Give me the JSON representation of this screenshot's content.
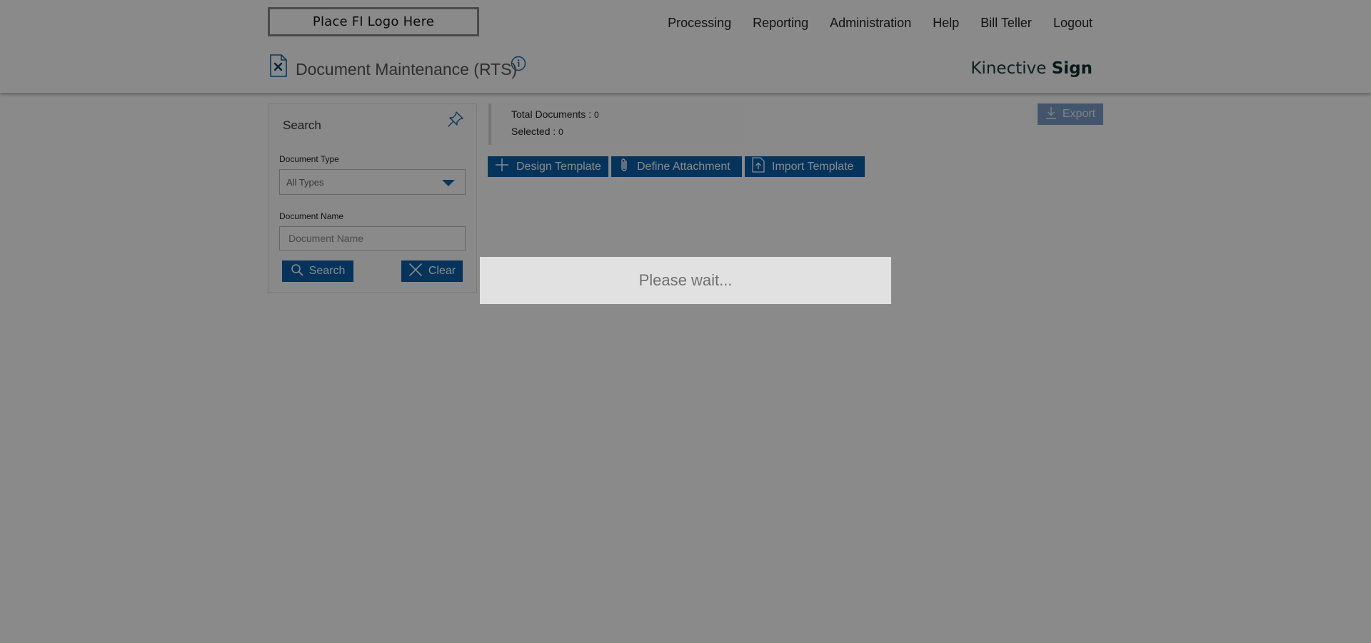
{
  "header": {
    "logo_text": "Place FI Logo Here",
    "nav": [
      "Processing",
      "Reporting",
      "Administration",
      "Help",
      "Bill Teller",
      "Logout"
    ]
  },
  "page": {
    "title": "Document Maintenance (RTS)",
    "brand_prefix": "Kinective ",
    "brand_bold": "Sign"
  },
  "search_panel": {
    "title": "Search",
    "doc_type_label": "Document Type",
    "doc_type_value": "All Types",
    "doc_name_label": "Document Name",
    "doc_name_placeholder": "Document Name",
    "search_button": "Search",
    "clear_button": "Clear"
  },
  "summary": {
    "total_label": "Total Documents : ",
    "total_value": "0",
    "selected_label": "Selected : ",
    "selected_value": "0"
  },
  "toolbar": {
    "design_template": "Design Template",
    "define_attachment": "Define Attachment",
    "import_template": "Import Template",
    "export": "Export"
  },
  "loading": {
    "message": "Please wait..."
  },
  "colors": {
    "primary_button": "#0b5eab",
    "overlay": "rgba(0,0,0,0.46)"
  }
}
